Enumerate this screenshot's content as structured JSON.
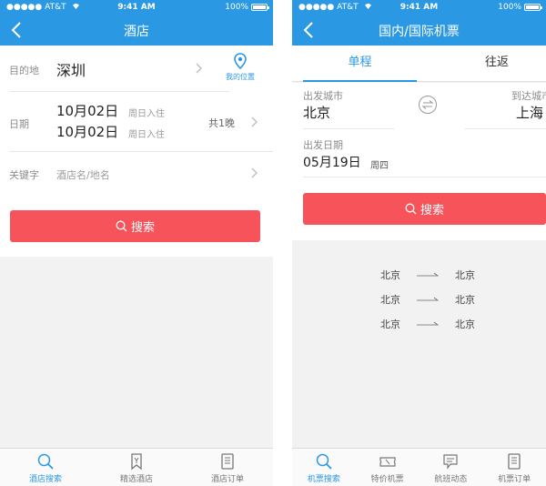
{
  "status": {
    "carrier": "AT&T",
    "time": "9:41 AM",
    "battery": "100%"
  },
  "hotel": {
    "title": "酒店",
    "destination_label": "目的地",
    "destination_value": "深圳",
    "location_label": "我的位置",
    "date_label": "日期",
    "checkin_date": "10月02日",
    "checkin_weekday": "周日入住",
    "checkout_date": "10月02日",
    "checkout_weekday": "周日入住",
    "nights": "共1晚",
    "keyword_label": "关键字",
    "keyword_placeholder": "酒店名/地名",
    "search_label": "搜索",
    "tabs": [
      {
        "label": "酒店搜索",
        "icon": "search-icon"
      },
      {
        "label": "精选酒店",
        "icon": "bookmark-icon"
      },
      {
        "label": "酒店订单",
        "icon": "list-icon"
      }
    ]
  },
  "flight": {
    "title": "国内/国际机票",
    "segments": [
      "单程",
      "往返"
    ],
    "from_label": "出发城市",
    "from_value": "北京",
    "to_label": "到达城市",
    "to_value": "上海",
    "swap_icon": "swap-icon",
    "date_label": "出发日期",
    "date_value": "05月19日",
    "weekday": "周四",
    "search_label": "搜索",
    "history": [
      {
        "from": "北京",
        "to": "北京"
      },
      {
        "from": "北京",
        "to": "北京"
      },
      {
        "from": "北京",
        "to": "北京"
      }
    ],
    "tabs": [
      {
        "label": "机票搜索",
        "icon": "search-icon"
      },
      {
        "label": "特价机票",
        "icon": "ticket-icon"
      },
      {
        "label": "航班动态",
        "icon": "message-icon"
      },
      {
        "label": "机票订单",
        "icon": "list-icon"
      }
    ]
  },
  "colors": {
    "primary": "#2b98e3",
    "search": "#f7535a",
    "background": "#f2f2f2"
  }
}
